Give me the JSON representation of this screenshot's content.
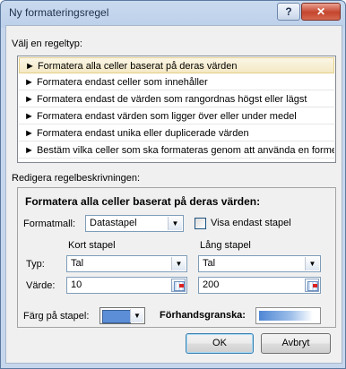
{
  "window": {
    "title": "Ny formateringsregel",
    "help_label": "?",
    "close_label": "✕"
  },
  "rule_types": {
    "label": "Välj en regeltyp:",
    "items": [
      {
        "label": "► Formatera alla celler baserat på deras värden",
        "selected": true
      },
      {
        "label": "► Formatera endast celler som innehåller",
        "selected": false
      },
      {
        "label": "► Formatera endast de värden som rangordnas högst eller lägst",
        "selected": false
      },
      {
        "label": "► Formatera endast värden som ligger över eller under medel",
        "selected": false
      },
      {
        "label": "► Formatera endast unika eller duplicerade värden",
        "selected": false
      },
      {
        "label": "► Bestäm vilka celler som ska formateras genom att använda en formel",
        "selected": false
      }
    ]
  },
  "edit": {
    "label": "Redigera regelbeskrivningen:",
    "heading": "Formatera alla celler baserat på deras värden:",
    "format_style_label": "Formatmall:",
    "format_style_value": "Datastapel",
    "show_only_bar_label": "Visa endast stapel",
    "show_only_bar_checked": false,
    "short_bar_label": "Kort stapel",
    "long_bar_label": "Lång stapel",
    "type_label": "Typ:",
    "value_label": "Värde:",
    "short_type": "Tal",
    "long_type": "Tal",
    "short_value": "10",
    "long_value": "200",
    "bar_color_label": "Färg på stapel:",
    "preview_label": "Förhandsgranska:"
  },
  "colors": {
    "bar_color": "#5b8ed6"
  },
  "buttons": {
    "ok": "OK",
    "cancel": "Avbryt"
  }
}
